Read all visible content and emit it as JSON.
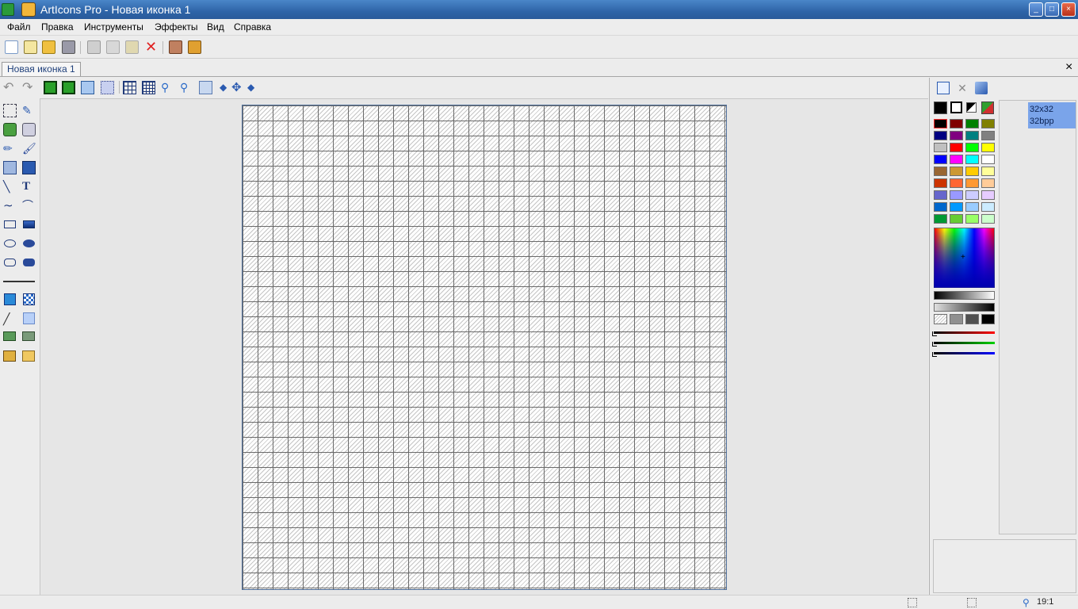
{
  "window": {
    "title": "ArtIcons Pro - Новая иконка 1"
  },
  "menu": [
    "Файл",
    "Правка",
    "Инструменты",
    "Эффекты",
    "Вид",
    "Справка"
  ],
  "tabs": {
    "document": "Новая иконка 1",
    "close_symbol": "×"
  },
  "window_buttons": {
    "minimize": "_",
    "maximize": "□",
    "close": "×"
  },
  "format": {
    "size": "32x32",
    "depth": "32bpp"
  },
  "status": {
    "zoom": "19:1"
  },
  "palette_colors": [
    [
      "#000000",
      "#800000",
      "#008000",
      "#808000"
    ],
    [
      "#000080",
      "#800080",
      "#008080",
      "#808080"
    ],
    [
      "#c0c0c0",
      "#ff0000",
      "#00ff00",
      "#ffff00"
    ],
    [
      "#0000ff",
      "#ff00ff",
      "#00ffff",
      "#ffffff"
    ],
    [
      "#996633",
      "#cc9933",
      "#ffcc00",
      "#ffff99"
    ],
    [
      "#cc3300",
      "#ff6633",
      "#ff9933",
      "#ffcc99"
    ],
    [
      "#6666cc",
      "#9999ff",
      "#ccccff",
      "#e6ccff"
    ],
    [
      "#0066cc",
      "#0099ff",
      "#99ccff",
      "#ccecff"
    ],
    [
      "#009933",
      "#66cc33",
      "#99ff66",
      "#ccffcc"
    ]
  ],
  "icons": {
    "toolbar": [
      "new-file-icon",
      "new-from-template-icon",
      "open-folder-icon",
      "save-icon",
      "cut-icon",
      "copy-icon",
      "paste-icon",
      "delete-icon",
      "resources-icon",
      "library-icon"
    ],
    "toolbar2": [
      "undo-icon",
      "redo-icon",
      "layer-fill-icon",
      "layer-frame-icon",
      "layer-3d-icon",
      "select-all-icon",
      "grid-icon",
      "grid-alt-icon",
      "zoom-in-icon",
      "zoom-out-icon",
      "antialias-icon",
      "arrow-left-icon",
      "move-icon",
      "arrow-right-icon"
    ],
    "right_panel": [
      "add-format-icon",
      "remove-format-icon",
      "eraser-icon"
    ]
  }
}
